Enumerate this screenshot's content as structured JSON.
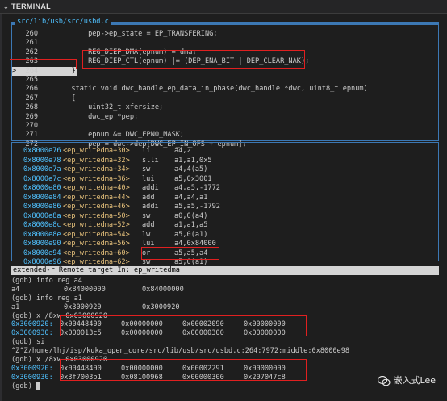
{
  "panel": {
    "title": "TERMINAL"
  },
  "source": {
    "file_path": "src/lib/usb/src/usbd.c",
    "lines": [
      {
        "num": "260",
        "code": "            pep->ep_state = EP_TRANSFERING;"
      },
      {
        "num": "261",
        "code": ""
      },
      {
        "num": "262",
        "code": "            REG_DIEP_DMA(epnum) = dma;"
      },
      {
        "num": "263",
        "code": "            REG_DIEP_CTL(epnum) |= (DEP_ENA_BIT | DEP_CLEAR_NAK);"
      },
      {
        "num": "264",
        "code": "        }",
        "current": true
      },
      {
        "num": "265",
        "code": ""
      },
      {
        "num": "266",
        "code": "        static void dwc_handle_ep_data_in_phase(dwc_handle *dwc, uint8_t epnum)"
      },
      {
        "num": "267",
        "code": "        {"
      },
      {
        "num": "268",
        "code": "            uint32_t xfersize;"
      },
      {
        "num": "269",
        "code": "            dwc_ep *pep;"
      },
      {
        "num": "270",
        "code": ""
      },
      {
        "num": "271",
        "code": "            epnum &= DWC_EPNO_MASK;"
      },
      {
        "num": "272",
        "code": "            pep = dwc->dep[DWC_EP_IN_OFS + epnum];"
      }
    ]
  },
  "asm": [
    {
      "addr": "0x8000e76",
      "sym": "<ep_writedma+30>",
      "mn": "li",
      "ops": "a4,2"
    },
    {
      "addr": "0x8000e78",
      "sym": "<ep_writedma+32>",
      "mn": "slli",
      "ops": "a1,a1,0x5"
    },
    {
      "addr": "0x8000e7a",
      "sym": "<ep_writedma+34>",
      "mn": "sw",
      "ops": "a4,4(a5)"
    },
    {
      "addr": "0x8000e7c",
      "sym": "<ep_writedma+36>",
      "mn": "lui",
      "ops": "a5,0x3001"
    },
    {
      "addr": "0x8000e80",
      "sym": "<ep_writedma+40>",
      "mn": "addi",
      "ops": "a4,a5,-1772"
    },
    {
      "addr": "0x8000e84",
      "sym": "<ep_writedma+44>",
      "mn": "add",
      "ops": "a4,a4,a1"
    },
    {
      "addr": "0x8000e86",
      "sym": "<ep_writedma+46>",
      "mn": "addi",
      "ops": "a5,a5,-1792"
    },
    {
      "addr": "0x8000e8a",
      "sym": "<ep_writedma+50>",
      "mn": "sw",
      "ops": "a0,0(a4)"
    },
    {
      "addr": "0x8000e8c",
      "sym": "<ep_writedma+52>",
      "mn": "add",
      "ops": "a1,a1,a5"
    },
    {
      "addr": "0x8000e8e",
      "sym": "<ep_writedma+54>",
      "mn": "lw",
      "ops": "a5,0(a1)"
    },
    {
      "addr": "0x8000e90",
      "sym": "<ep_writedma+56>",
      "mn": "lui",
      "ops": "a4,0x84000"
    },
    {
      "addr": "0x8000e94",
      "sym": "<ep_writedma+60>",
      "mn": "or",
      "ops": "a5,a5,a4"
    },
    {
      "addr": "0x8000e96",
      "sym": "<ep_writedma+62>",
      "mn": "sw",
      "ops": "a5,0(a1)"
    }
  ],
  "status_line": "extended-r Remote target In: ep_writedma",
  "gdb": [
    {
      "type": "text",
      "text": "(gdb) info reg a4"
    },
    {
      "type": "reg",
      "name": "a4",
      "hex": "0x84000000",
      "dec": "0x84000000"
    },
    {
      "type": "text",
      "text": "(gdb) info reg a1"
    },
    {
      "type": "reg",
      "name": "a1",
      "hex": "0x3000920",
      "dec": "0x3000920"
    },
    {
      "type": "text",
      "text": "(gdb) x /8xw 0x03000920"
    },
    {
      "type": "mem",
      "addr": "0x3000920:",
      "w": [
        "0x00448400",
        "0x00000000",
        "0x00002090",
        "0x00000000"
      ]
    },
    {
      "type": "mem",
      "addr": "0x3000930:",
      "w": [
        "0x000013c5",
        "0x00000000",
        "0x00000300",
        "0x00000000"
      ]
    },
    {
      "type": "text",
      "text": "(gdb) si"
    },
    {
      "type": "text",
      "text": "^Z^Z/home/lhj/isp/kuka_open_core/src/lib/usb/src/usbd.c:264:7972:middle:0x8000e98"
    },
    {
      "type": "text",
      "text": "(gdb) x /8xw 0x03000920"
    },
    {
      "type": "mem",
      "addr": "0x3000920:",
      "w": [
        "0x00448400",
        "0x00000000",
        "0x00002291",
        "0x00000000"
      ]
    },
    {
      "type": "mem",
      "addr": "0x3000930:",
      "w": [
        "0x3f7003b1",
        "0x08100968",
        "0x00000300",
        "0x207047c8"
      ]
    },
    {
      "type": "prompt",
      "text": "(gdb) "
    }
  ],
  "watermark": "嵌入式Lee",
  "colors": {
    "highlight": "#e02020",
    "border": "#3c78b4",
    "addr": "#4fc1ff",
    "symbol": "#e5c07b"
  }
}
